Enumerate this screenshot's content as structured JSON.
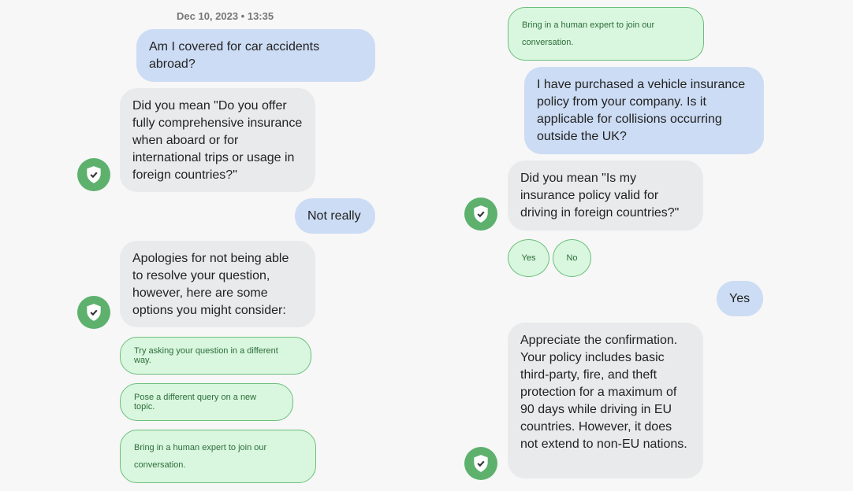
{
  "left_column": {
    "timestamp": "Dec 10, 2023 • 13:35",
    "messages": [
      {
        "role": "user",
        "text": "Am I covered for car accidents abroad?"
      },
      {
        "role": "bot",
        "text": "Did you mean \"Do you offer fully comprehensive insurance when aboard or for international trips or usage in foreign countries?\""
      },
      {
        "role": "user",
        "text": "Not really"
      },
      {
        "role": "bot",
        "text": "Apologies for not being able to resolve your question, however, here are some options you might consider:"
      }
    ],
    "suggestions": [
      "Try asking your question in a different way.",
      "Pose a different query on a new topic.",
      "Bring in a human expert to join our conversation."
    ]
  },
  "right_column": {
    "selected_suggestion": "Bring in a human expert to join our conversation.",
    "messages": [
      {
        "role": "user",
        "text": "I have purchased a vehicle insurance policy from your company. Is it applicable for collisions occurring outside the UK?"
      },
      {
        "role": "bot",
        "text": "Did you mean \"Is my insurance policy valid for driving in foreign countries?\""
      },
      {
        "role": "user",
        "text": "Yes"
      },
      {
        "role": "bot",
        "text": "Appreciate the confirmation. Your policy includes basic third-party, fire, and theft protection for a maximum of 90 days while driving in EU countries. However, it does not extend to non-EU nations."
      }
    ],
    "quick_replies": [
      "Yes",
      "No"
    ]
  },
  "icons": {
    "bot_avatar": "shield-check-icon"
  },
  "colors": {
    "user_bubble": "#ccdcf4",
    "bot_bubble": "#e9eaec",
    "chip_bg": "#d9f6de",
    "chip_border": "#6cbf7d",
    "avatar": "#5db16d"
  }
}
